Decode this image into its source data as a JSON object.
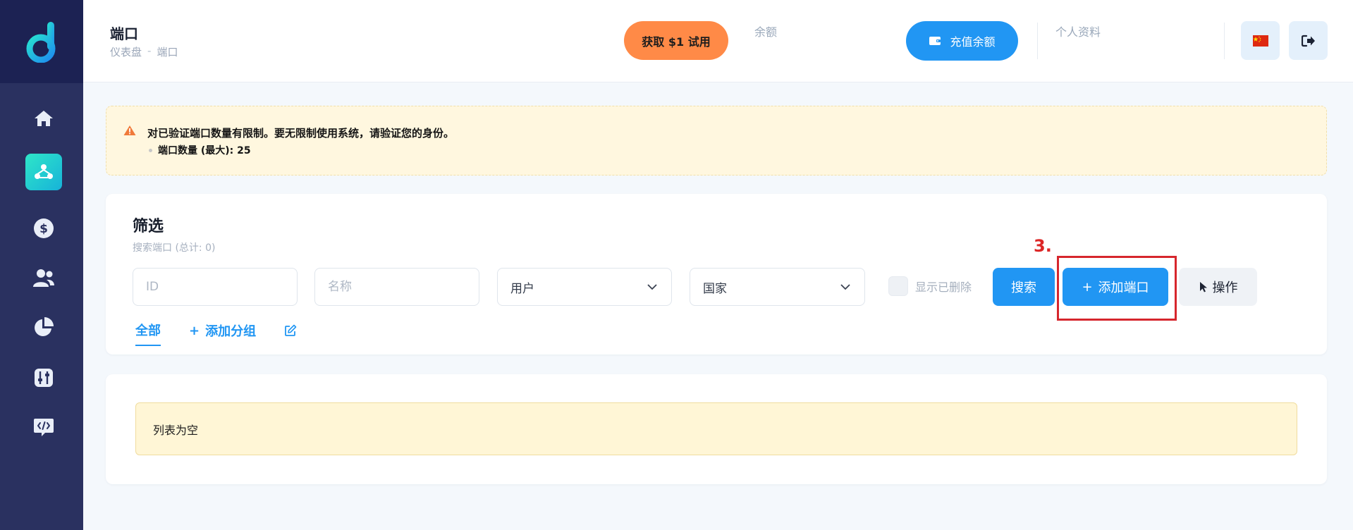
{
  "header": {
    "title": "端口",
    "breadcrumb": [
      "仪表盘",
      "端口"
    ],
    "trial_button": "获取 $1 试用",
    "balance_label": "余额",
    "recharge_button": "充值余额",
    "profile_label": "个人资料"
  },
  "sidebar": {
    "items": [
      {
        "name": "home-icon",
        "active": false
      },
      {
        "name": "network-icon",
        "active": true
      },
      {
        "name": "dollar-icon",
        "active": false
      },
      {
        "name": "users-icon",
        "active": false
      },
      {
        "name": "pie-chart-icon",
        "active": false
      },
      {
        "name": "sliders-icon",
        "active": false
      },
      {
        "name": "api-code-icon",
        "active": false
      }
    ]
  },
  "warning": {
    "text": "对已验证端口数量有限制。要无限制使用系统，请验证您的身份。",
    "bullet": "端口数量 (最大): 25"
  },
  "filter": {
    "title": "筛选",
    "subtitle": "搜索端口 (总计: 0)",
    "id_placeholder": "ID",
    "name_placeholder": "名称",
    "user_select": "用户",
    "country_select": "国家",
    "show_deleted": "显示已删除",
    "search_button": "搜索",
    "add_port_button": "添加端口",
    "action_button": "操作",
    "annotation": "3."
  },
  "tabs": {
    "all": "全部",
    "add_group": "添加分组"
  },
  "list": {
    "empty": "列表为空"
  },
  "colors": {
    "accent": "#2196f3",
    "orange": "#ff8a47",
    "sidebar": "#2a3160",
    "highlight": "#d6262d"
  }
}
